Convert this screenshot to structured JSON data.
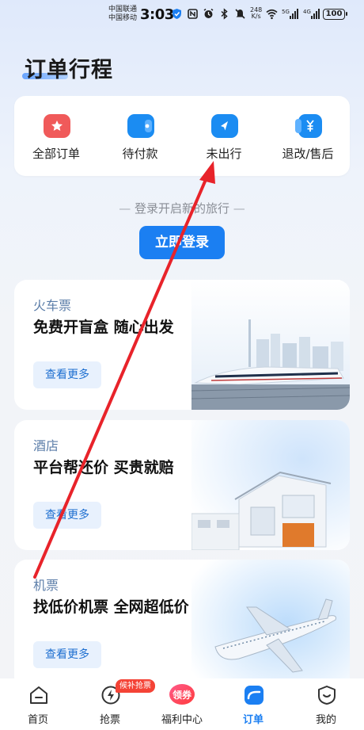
{
  "status_bar": {
    "carrier_1": "中国联通",
    "carrier_2": "中国移动",
    "time": "3:03",
    "net_speed_value": "248",
    "net_speed_unit": "K/s",
    "signal_1_label": "5G",
    "signal_2_label": "4G",
    "battery": "100"
  },
  "page": {
    "title": "订单行程"
  },
  "order_shortcuts": [
    {
      "label": "全部订单",
      "icon": "all-orders-icon",
      "color": "#f05a5a"
    },
    {
      "label": "待付款",
      "icon": "pending-payment-icon",
      "color": "#1b8cf2"
    },
    {
      "label": "未出行",
      "icon": "not-travelled-icon",
      "color": "#1b8cf2"
    },
    {
      "label": "退改/售后",
      "icon": "refund-change-icon",
      "color": "#1b8cf2"
    }
  ],
  "login": {
    "hint": "登录开启新的旅行",
    "dash": "—",
    "button_label": "立即登录"
  },
  "promo_cards": [
    {
      "category": "火车票",
      "slogan": "免费开盲盒 随心出发",
      "button": "查看更多",
      "art": "train-illustration"
    },
    {
      "category": "酒店",
      "slogan": "平台帮还价 买贵就赔",
      "button": "查看更多",
      "art": "hotel-illustration"
    },
    {
      "category": "机票",
      "slogan": "找低价机票 全网超低价",
      "button": "查看更多",
      "art": "airplane-illustration"
    }
  ],
  "bottom_nav": {
    "items": [
      {
        "label": "首页",
        "icon": "home-icon"
      },
      {
        "label": "抢票",
        "icon": "lightning-icon"
      },
      {
        "label": "福利中心",
        "icon": "coupon-icon",
        "icon_text": "领券"
      },
      {
        "label": "订单",
        "icon": "order-icon",
        "active": true
      },
      {
        "label": "我的",
        "icon": "profile-icon"
      }
    ],
    "badge": "候补抢票"
  },
  "colors": {
    "primary": "#1b7ff2",
    "annotation_arrow": "#e8232a"
  }
}
